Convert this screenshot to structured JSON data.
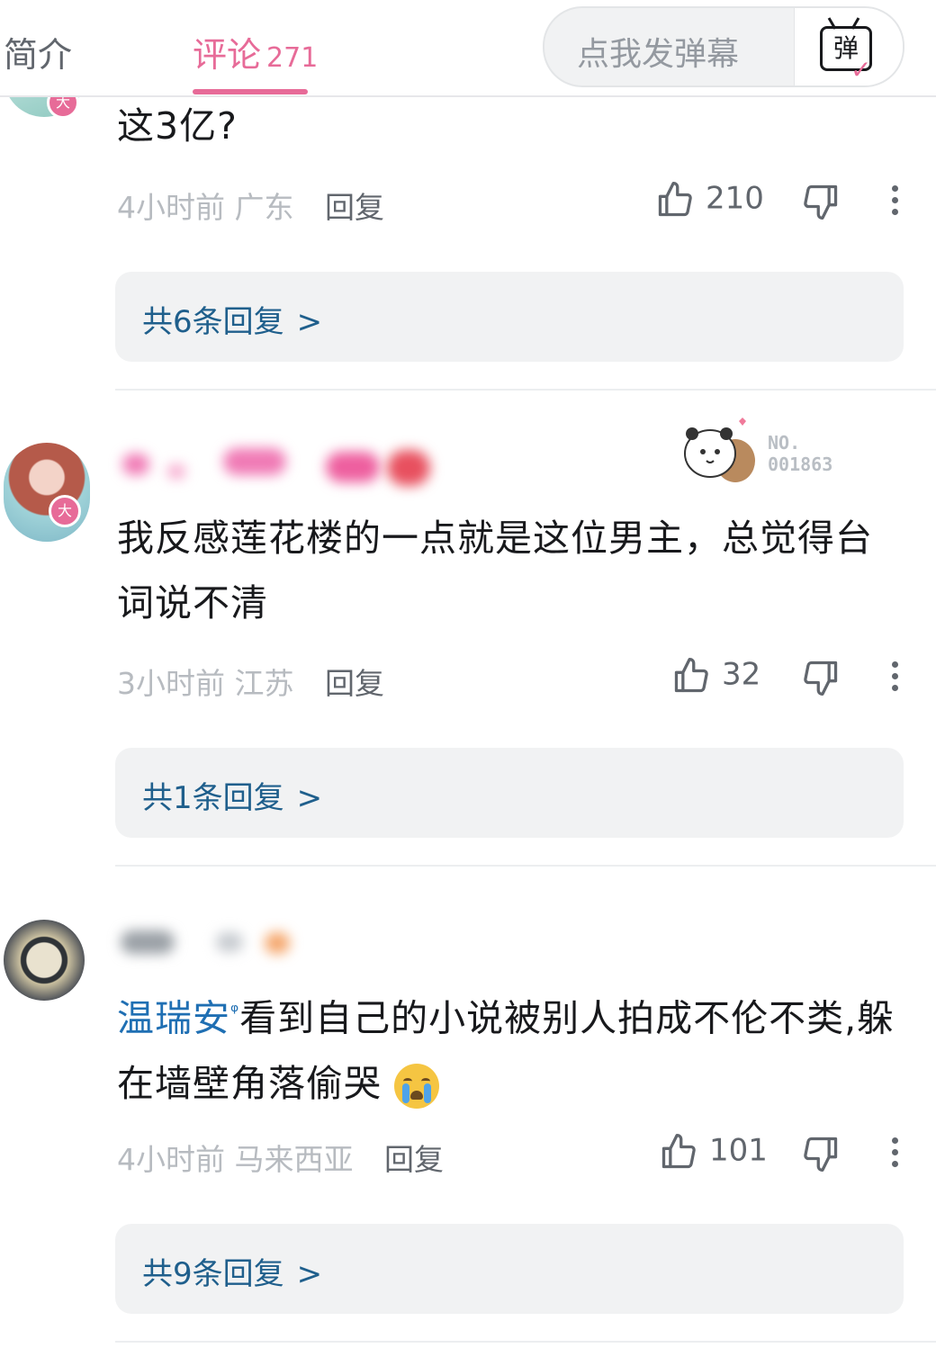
{
  "tabs": {
    "intro": "简介",
    "comments": "评论",
    "comments_count": "271"
  },
  "danmaku": {
    "placeholder": "点我发弹幕",
    "button_glyph": "弹"
  },
  "comments": [
    {
      "text": "这3亿?",
      "time": "4小时前",
      "region": "广东",
      "reply": "回复",
      "likes": "210",
      "replies_label": "共6条回复"
    },
    {
      "text": "我反感莲花楼的一点就是这位男主，总觉得台词说不清",
      "time": "3小时前",
      "region": "江苏",
      "reply": "回复",
      "likes": "32",
      "replies_label": "共1条回复",
      "vip_badge": "大",
      "sticker_no_1": "NO.",
      "sticker_no_2": "001863"
    },
    {
      "mention": "温瑞安",
      "text": "看到自己的小说被别人拍成不伦不类,躲在墙壁角落偷哭",
      "time": "4小时前",
      "region": "马来西亚",
      "reply": "回复",
      "likes": "101",
      "replies_label": "共9条回复"
    }
  ],
  "colors": {
    "accent_pink": "#e76b98",
    "link_blue": "#1f5f8c",
    "meta_gray": "#b7bbc0"
  }
}
